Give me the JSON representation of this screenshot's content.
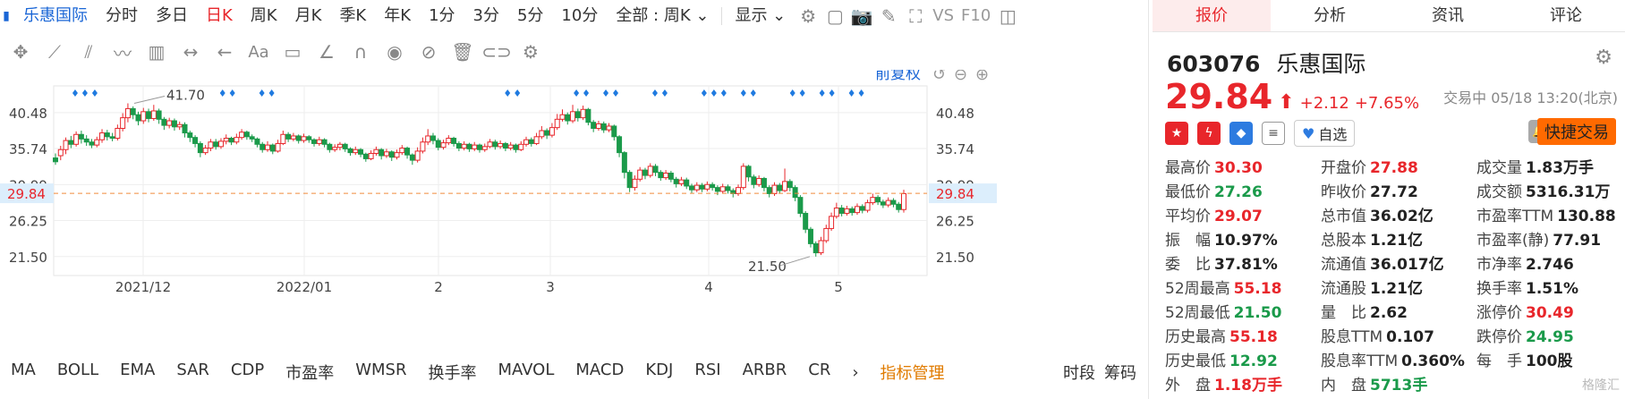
{
  "toolbar": {
    "stock_name": "乐惠国际",
    "periods": [
      "分时",
      "多日",
      "日K",
      "周K",
      "月K",
      "季K",
      "年K",
      "1分",
      "3分",
      "5分",
      "10分"
    ],
    "active_period": "日K",
    "range_select": "全部 : 周K",
    "display_label": "显示",
    "compare_label": "VS",
    "f10_label": "F10"
  },
  "draw_tools": {
    "text_tool": "Aa"
  },
  "chart": {
    "adjust_label": "前复权",
    "y_ticks": [
      "40.48",
      "35.74",
      "30.99",
      "26.25",
      "21.50"
    ],
    "current_price_label": "29.84",
    "x_ticks": [
      "2021/12",
      "2022/01",
      "2",
      "3",
      "4",
      "5"
    ],
    "high_annotation": "41.70",
    "low_annotation": "21.50",
    "colors": {
      "up": "#e8262b",
      "down": "#1a9a4a",
      "marker": "#1f7ae0",
      "grid": "#eeeeee",
      "price_line": "#f08a3c",
      "price_bg": "#dceefc"
    }
  },
  "chart_data": {
    "type": "candlestick",
    "ylim": [
      19,
      44
    ],
    "candles": [
      [
        34.5,
        34.0,
        35.1,
        33.6
      ],
      [
        34.8,
        35.6,
        36.1,
        34.2
      ],
      [
        35.6,
        36.8,
        37.2,
        35.0
      ],
      [
        36.8,
        36.3,
        37.4,
        35.8
      ],
      [
        36.3,
        37.6,
        38.0,
        36.0
      ],
      [
        37.6,
        37.0,
        38.1,
        36.4
      ],
      [
        37.0,
        36.6,
        37.5,
        36.1
      ],
      [
        36.6,
        36.2,
        37.0,
        35.8
      ],
      [
        36.2,
        36.9,
        37.3,
        35.9
      ],
      [
        36.9,
        37.8,
        38.3,
        36.5
      ],
      [
        37.8,
        37.3,
        38.2,
        36.8
      ],
      [
        37.3,
        37.1,
        37.8,
        36.7
      ],
      [
        37.1,
        38.4,
        38.9,
        36.8
      ],
      [
        38.4,
        39.8,
        40.4,
        38.0
      ],
      [
        39.8,
        41.0,
        41.7,
        39.2
      ],
      [
        41.0,
        40.2,
        41.3,
        39.6
      ],
      [
        40.2,
        39.4,
        40.6,
        38.8
      ],
      [
        39.4,
        40.6,
        41.1,
        39.0
      ],
      [
        40.6,
        39.7,
        41.0,
        39.2
      ],
      [
        39.7,
        40.7,
        41.5,
        39.4
      ],
      [
        40.7,
        39.6,
        41.0,
        39.0
      ],
      [
        39.6,
        38.8,
        39.9,
        38.2
      ],
      [
        38.8,
        39.4,
        39.8,
        38.4
      ],
      [
        39.4,
        38.6,
        39.7,
        38.1
      ],
      [
        38.6,
        38.9,
        39.3,
        38.2
      ],
      [
        38.9,
        37.8,
        39.2,
        37.2
      ],
      [
        37.8,
        37.2,
        38.1,
        36.6
      ],
      [
        37.2,
        36.4,
        37.5,
        35.9
      ],
      [
        36.4,
        35.2,
        36.7,
        34.6
      ],
      [
        35.2,
        35.8,
        36.2,
        34.9
      ],
      [
        35.8,
        36.6,
        37.0,
        35.4
      ],
      [
        36.6,
        36.0,
        37.0,
        35.6
      ],
      [
        36.0,
        36.7,
        37.1,
        35.7
      ],
      [
        36.7,
        37.1,
        37.6,
        36.3
      ],
      [
        37.1,
        36.6,
        37.3,
        36.2
      ],
      [
        36.6,
        37.2,
        37.7,
        36.3
      ],
      [
        37.2,
        37.9,
        38.3,
        36.9
      ],
      [
        37.9,
        37.3,
        38.1,
        36.9
      ],
      [
        37.3,
        37.0,
        37.6,
        36.6
      ],
      [
        37.0,
        36.3,
        37.2,
        35.9
      ],
      [
        36.3,
        35.6,
        36.6,
        35.2
      ],
      [
        35.6,
        36.2,
        36.7,
        35.3
      ],
      [
        36.2,
        35.4,
        36.4,
        35.0
      ],
      [
        35.4,
        36.4,
        36.9,
        35.2
      ],
      [
        36.4,
        37.6,
        38.1,
        36.2
      ],
      [
        37.6,
        37.0,
        37.9,
        36.6
      ],
      [
        37.0,
        37.4,
        37.8,
        36.7
      ],
      [
        37.4,
        36.8,
        37.6,
        36.4
      ],
      [
        36.8,
        37.3,
        37.7,
        36.5
      ],
      [
        37.3,
        36.9,
        37.5,
        36.5
      ],
      [
        36.9,
        36.4,
        37.1,
        36.0
      ],
      [
        36.4,
        36.9,
        37.3,
        36.1
      ],
      [
        36.9,
        36.3,
        37.1,
        35.9
      ],
      [
        36.3,
        35.6,
        36.5,
        35.2
      ],
      [
        35.6,
        35.9,
        36.3,
        35.3
      ],
      [
        35.9,
        36.3,
        36.6,
        35.5
      ],
      [
        36.3,
        35.7,
        36.5,
        35.3
      ],
      [
        35.7,
        35.2,
        35.9,
        34.8
      ],
      [
        35.2,
        35.6,
        36.0,
        34.9
      ],
      [
        35.6,
        35.0,
        35.8,
        34.6
      ],
      [
        35.0,
        34.4,
        35.2,
        34.0
      ],
      [
        34.4,
        35.1,
        35.5,
        34.2
      ],
      [
        35.1,
        35.6,
        36.0,
        34.8
      ],
      [
        35.6,
        34.8,
        35.8,
        34.3
      ],
      [
        34.8,
        35.3,
        35.7,
        34.5
      ],
      [
        35.3,
        34.6,
        35.5,
        34.1
      ],
      [
        34.6,
        35.2,
        35.6,
        34.3
      ],
      [
        35.2,
        35.8,
        36.2,
        34.9
      ],
      [
        35.8,
        34.9,
        36.0,
        34.4
      ],
      [
        34.9,
        34.2,
        35.1,
        33.6
      ],
      [
        34.2,
        35.4,
        35.9,
        33.9
      ],
      [
        35.4,
        36.6,
        37.2,
        35.1
      ],
      [
        36.6,
        37.4,
        38.3,
        36.2
      ],
      [
        37.4,
        36.8,
        37.8,
        36.3
      ],
      [
        36.8,
        35.9,
        37.1,
        35.5
      ],
      [
        35.9,
        36.5,
        36.9,
        35.6
      ],
      [
        36.5,
        37.1,
        37.5,
        36.2
      ],
      [
        37.1,
        36.4,
        37.3,
        36.0
      ],
      [
        36.4,
        35.8,
        36.7,
        35.4
      ],
      [
        35.8,
        36.3,
        36.7,
        35.5
      ],
      [
        36.3,
        35.7,
        36.5,
        35.3
      ],
      [
        35.7,
        36.2,
        36.6,
        35.4
      ],
      [
        36.2,
        35.6,
        36.4,
        35.2
      ],
      [
        35.6,
        36.0,
        36.4,
        35.3
      ],
      [
        36.0,
        36.6,
        37.0,
        35.8
      ],
      [
        36.6,
        36.0,
        36.9,
        35.6
      ],
      [
        36.0,
        36.4,
        36.8,
        35.7
      ],
      [
        36.4,
        35.8,
        36.6,
        35.4
      ],
      [
        35.8,
        36.2,
        36.6,
        35.5
      ],
      [
        36.2,
        35.6,
        36.4,
        35.2
      ],
      [
        35.6,
        36.3,
        36.7,
        35.4
      ],
      [
        36.3,
        36.9,
        37.3,
        36.0
      ],
      [
        36.9,
        36.4,
        37.2,
        36.0
      ],
      [
        36.4,
        37.3,
        37.8,
        36.2
      ],
      [
        37.3,
        38.1,
        38.7,
        37.0
      ],
      [
        38.1,
        37.5,
        38.4,
        37.0
      ],
      [
        37.5,
        38.5,
        39.1,
        37.2
      ],
      [
        38.5,
        39.6,
        40.3,
        38.2
      ],
      [
        39.6,
        40.2,
        40.9,
        39.3
      ],
      [
        40.2,
        39.4,
        40.5,
        38.9
      ],
      [
        39.4,
        40.6,
        41.5,
        39.1
      ],
      [
        40.6,
        39.8,
        41.0,
        39.3
      ],
      [
        39.8,
        40.9,
        41.4,
        39.5
      ],
      [
        40.9,
        39.2,
        41.1,
        38.8
      ],
      [
        39.2,
        38.4,
        39.5,
        37.9
      ],
      [
        38.4,
        39.0,
        39.4,
        38.1
      ],
      [
        39.0,
        38.2,
        39.3,
        37.8
      ],
      [
        38.2,
        38.7,
        39.1,
        37.9
      ],
      [
        38.7,
        37.3,
        38.9,
        36.8
      ],
      [
        37.3,
        35.2,
        37.5,
        34.6
      ],
      [
        35.2,
        32.6,
        35.4,
        31.8
      ],
      [
        32.6,
        30.6,
        32.9,
        30.0
      ],
      [
        30.6,
        31.7,
        32.2,
        30.2
      ],
      [
        31.7,
        32.9,
        33.3,
        31.4
      ],
      [
        32.9,
        32.2,
        33.2,
        31.7
      ],
      [
        32.2,
        33.4,
        33.8,
        31.9
      ],
      [
        33.4,
        32.6,
        33.7,
        32.1
      ],
      [
        32.6,
        31.9,
        32.9,
        31.5
      ],
      [
        31.9,
        32.5,
        32.9,
        31.6
      ],
      [
        32.5,
        31.7,
        32.8,
        31.3
      ],
      [
        31.7,
        31.1,
        32.0,
        30.6
      ],
      [
        31.1,
        31.6,
        32.0,
        30.8
      ],
      [
        31.6,
        30.8,
        31.9,
        30.4
      ],
      [
        30.8,
        30.3,
        31.1,
        29.9
      ],
      [
        30.3,
        30.9,
        31.3,
        30.0
      ],
      [
        30.9,
        30.4,
        31.2,
        30.0
      ],
      [
        30.4,
        31.0,
        31.4,
        30.1
      ],
      [
        31.0,
        30.6,
        31.3,
        30.2
      ],
      [
        30.6,
        30.1,
        30.9,
        29.6
      ],
      [
        30.1,
        30.7,
        31.1,
        29.8
      ],
      [
        30.7,
        30.2,
        31.0,
        29.8
      ],
      [
        30.2,
        29.8,
        30.5,
        29.3
      ],
      [
        29.8,
        30.6,
        31.0,
        29.5
      ],
      [
        30.6,
        33.4,
        33.8,
        30.3
      ],
      [
        33.4,
        32.0,
        33.6,
        31.4
      ],
      [
        32.0,
        31.0,
        32.3,
        30.5
      ],
      [
        31.0,
        31.8,
        32.2,
        30.7
      ],
      [
        31.8,
        30.6,
        32.0,
        30.1
      ],
      [
        30.6,
        29.8,
        30.9,
        29.3
      ],
      [
        29.8,
        30.9,
        31.3,
        29.5
      ],
      [
        30.9,
        30.2,
        31.2,
        29.8
      ],
      [
        30.2,
        31.4,
        33.1,
        30.0
      ],
      [
        31.4,
        30.6,
        31.7,
        30.1
      ],
      [
        30.6,
        29.3,
        30.9,
        28.8
      ],
      [
        29.3,
        27.2,
        29.6,
        26.7
      ],
      [
        27.2,
        25.1,
        27.5,
        24.6
      ],
      [
        25.1,
        23.2,
        25.4,
        22.7
      ],
      [
        23.2,
        22.0,
        23.5,
        21.5
      ],
      [
        22.0,
        23.6,
        24.1,
        21.7
      ],
      [
        23.6,
        25.2,
        25.7,
        23.3
      ],
      [
        25.2,
        26.8,
        27.3,
        24.9
      ],
      [
        26.8,
        27.9,
        28.6,
        26.5
      ],
      [
        27.9,
        27.2,
        28.3,
        26.8
      ],
      [
        27.2,
        27.8,
        28.2,
        26.9
      ],
      [
        27.8,
        27.3,
        28.1,
        26.9
      ],
      [
        27.3,
        28.1,
        28.5,
        27.0
      ],
      [
        28.1,
        27.6,
        28.4,
        27.2
      ],
      [
        27.6,
        28.6,
        29.0,
        27.3
      ],
      [
        28.6,
        29.3,
        29.8,
        28.3
      ],
      [
        29.3,
        28.7,
        29.6,
        28.3
      ],
      [
        28.7,
        28.3,
        29.0,
        27.9
      ],
      [
        28.3,
        28.9,
        29.3,
        28.0
      ],
      [
        28.9,
        28.4,
        29.2,
        28.0
      ],
      [
        28.4,
        27.7,
        28.7,
        27.3
      ],
      [
        27.7,
        29.8,
        30.3,
        27.3
      ]
    ],
    "markers": [
      2,
      3,
      4,
      17,
      18,
      21,
      22,
      46,
      47,
      53,
      54,
      56,
      57,
      61,
      62,
      66,
      67,
      68,
      70,
      71,
      75,
      76,
      78,
      79,
      81,
      82,
      86,
      87,
      88,
      89
    ]
  },
  "indicators": {
    "items": [
      "MA",
      "BOLL",
      "EMA",
      "SAR",
      "CDP",
      "市盈率",
      "WMSR",
      "换手率",
      "MAVOL",
      "MACD",
      "KDJ",
      "RSI",
      "ARBR",
      "CR"
    ],
    "manage_label": "指标管理",
    "right_items": [
      "时段",
      "筹码"
    ]
  },
  "panel": {
    "tabs": [
      "报价",
      "分析",
      "资讯",
      "评论"
    ],
    "active_tab": "报价",
    "code": "603076",
    "name": "乐惠国际",
    "price": "29.84",
    "arrow": "⬆",
    "change": "+2.12",
    "change_pct": "+7.65%",
    "status_time": "交易中 05/18 13:20(北京)",
    "watch_label": "自选",
    "quick_trade": "快捷交易",
    "stats": [
      {
        "label": "最高价",
        "value": "30.30",
        "color": "red"
      },
      {
        "label": "开盘价",
        "value": "27.88",
        "color": "red"
      },
      {
        "label": "成交量",
        "value": "1.83万手",
        "color": "dark"
      },
      {
        "label": "最低价",
        "value": "27.26",
        "color": "green"
      },
      {
        "label": "昨收价",
        "value": "27.72",
        "color": "dark"
      },
      {
        "label": "成交额",
        "value": "5316.31万",
        "color": "dark"
      },
      {
        "label": "平均价",
        "value": "29.07",
        "color": "red"
      },
      {
        "label": "总市值",
        "value": "36.02亿",
        "color": "dark"
      },
      {
        "label": "市盈率TTM",
        "value": "130.88",
        "color": "dark"
      },
      {
        "label": "振　幅",
        "value": "10.97%",
        "color": "dark"
      },
      {
        "label": "总股本",
        "value": "1.21亿",
        "color": "dark"
      },
      {
        "label": "市盈率(静)",
        "value": "77.91",
        "color": "dark"
      },
      {
        "label": "委　比",
        "value": "37.81%",
        "color": "dark"
      },
      {
        "label": "流通值",
        "value": "36.017亿",
        "color": "dark"
      },
      {
        "label": "市净率",
        "value": "2.746",
        "color": "dark"
      },
      {
        "label": "52周最高",
        "value": "55.18",
        "color": "red"
      },
      {
        "label": "流通股",
        "value": "1.21亿",
        "color": "dark"
      },
      {
        "label": "换手率",
        "value": "1.51%",
        "color": "dark"
      },
      {
        "label": "52周最低",
        "value": "21.50",
        "color": "green"
      },
      {
        "label": "量　比",
        "value": "2.62",
        "color": "dark"
      },
      {
        "label": "涨停价",
        "value": "30.49",
        "color": "red"
      },
      {
        "label": "历史最高",
        "value": "55.18",
        "color": "red"
      },
      {
        "label": "股息TTM",
        "value": "0.107",
        "color": "dark"
      },
      {
        "label": "跌停价",
        "value": "24.95",
        "color": "green"
      },
      {
        "label": "历史最低",
        "value": "12.92",
        "color": "green"
      },
      {
        "label": "股息率TTM",
        "value": "0.360%",
        "color": "dark"
      },
      {
        "label": "每　手",
        "value": "100股",
        "color": "dark"
      },
      {
        "label": "外　盘",
        "value": "1.18万手",
        "color": "red"
      },
      {
        "label": "内　盘",
        "value": "5713手",
        "color": "green"
      }
    ],
    "watermark": "格隆汇"
  }
}
